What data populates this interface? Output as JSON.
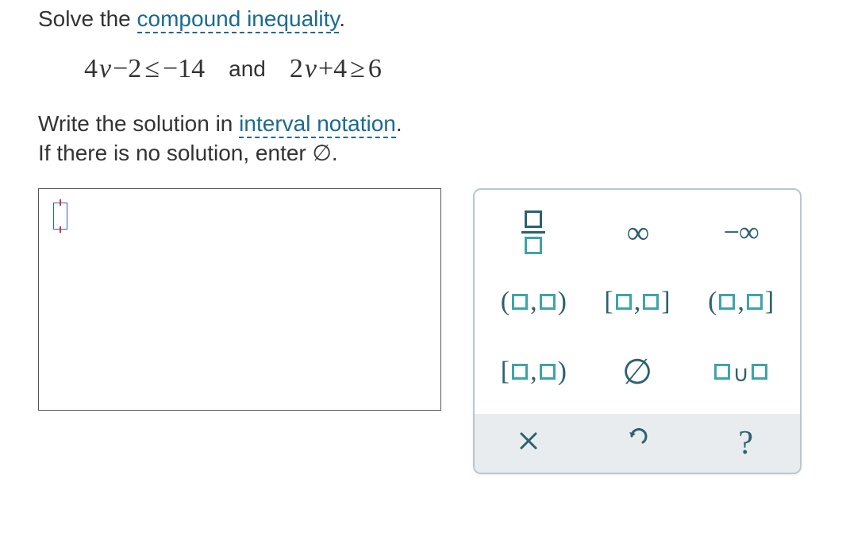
{
  "prompt": {
    "text_before": "Solve the ",
    "link1": "compound inequality",
    "text_after": "."
  },
  "math": {
    "expr1_a": "4",
    "expr1_var": "v",
    "expr1_b": "−2",
    "expr1_rel": "≤",
    "expr1_c": "−14",
    "joiner": "and",
    "expr2_a": "2",
    "expr2_var": "v",
    "expr2_b": "+4",
    "expr2_rel": "≥",
    "expr2_c": "6"
  },
  "instruction": {
    "line2_a": "Write the solution in ",
    "line2_link": "interval notation",
    "line2_b": ".",
    "line3": "If there is no solution, enter ∅."
  },
  "pad": {
    "infinity": "∞",
    "neg_infinity": "−∞",
    "empty_set": "∅",
    "open_open_l": "(",
    "open_open_r": ")",
    "closed_closed_l": "[",
    "closed_closed_r": "]",
    "open_closed_l": "(",
    "open_closed_r": "]",
    "closed_open_l": "[",
    "closed_open_r": ")",
    "comma": ",",
    "union": "∪",
    "clear": "×",
    "undo": "↶",
    "help": "?"
  }
}
